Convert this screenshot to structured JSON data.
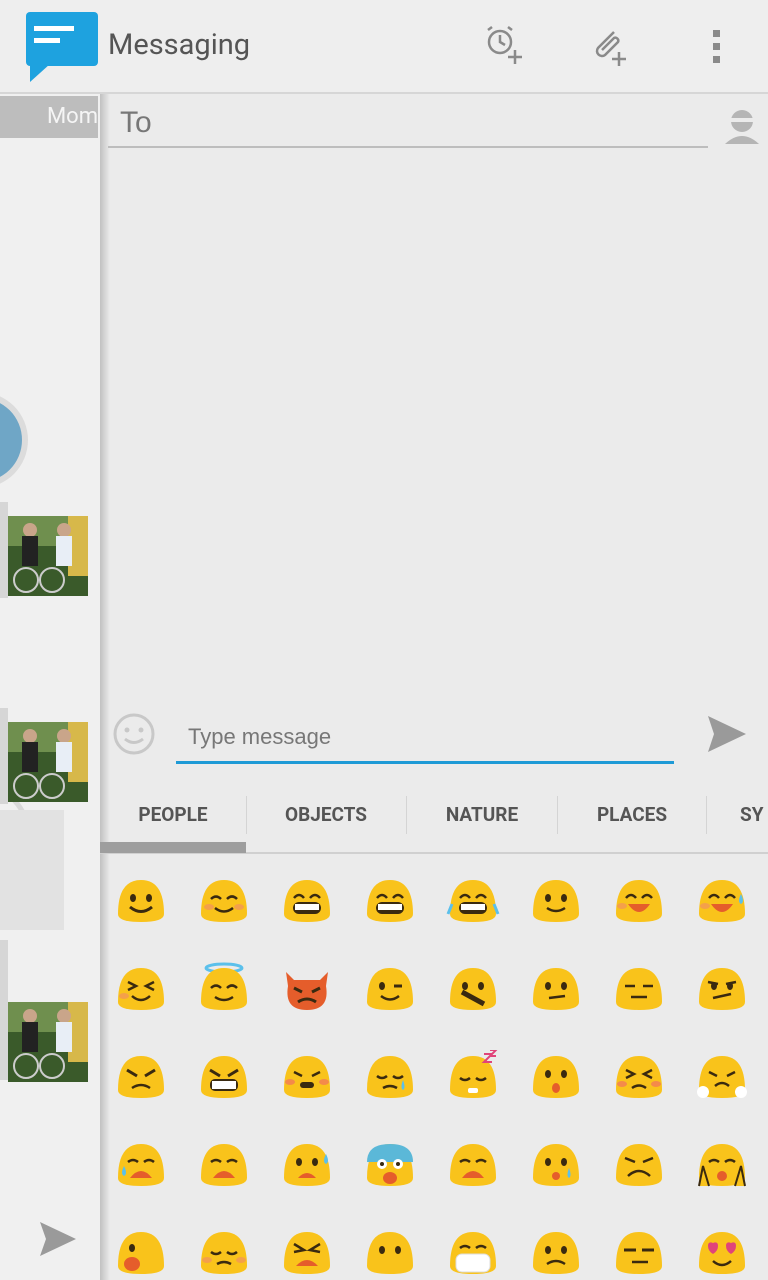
{
  "app": {
    "title": "Messaging"
  },
  "toolbar": {
    "schedule_icon": "alarm-plus-icon",
    "attach_icon": "paperclip-plus-icon",
    "overflow_icon": "more-vertical-icon"
  },
  "left_panel": {
    "contact_label": "Mom"
  },
  "compose": {
    "to_placeholder": "To",
    "message_placeholder": "Type message"
  },
  "emoji_tabs": [
    {
      "label": "PEOPLE"
    },
    {
      "label": "OBJECTS"
    },
    {
      "label": "NATURE"
    },
    {
      "label": "PLACES"
    },
    {
      "label": "SY"
    }
  ],
  "colors": {
    "accent": "#1e9ad6",
    "emoji_yellow": "#f9c31b",
    "emoji_red": "#e55d2b",
    "background": "#ebebeb"
  }
}
